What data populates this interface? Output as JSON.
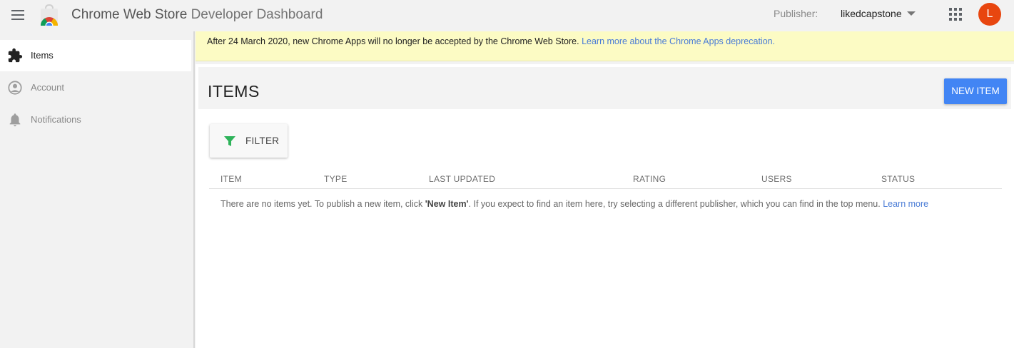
{
  "header": {
    "title_strong": "Chrome Web Store",
    "title_light": "Developer Dashboard",
    "publisher_label": "Publisher:",
    "publisher_value": "likedcapstone",
    "avatar_initial": "L"
  },
  "sidebar": {
    "items": [
      {
        "label": "Items",
        "icon": "puzzle-icon",
        "active": true
      },
      {
        "label": "Account",
        "icon": "account-circle-icon",
        "active": false
      },
      {
        "label": "Notifications",
        "icon": "bell-icon",
        "active": false
      }
    ]
  },
  "banner": {
    "text": "After 24 March 2020, new Chrome Apps will no longer be accepted by the Chrome Web Store.",
    "link": "Learn more about the Chrome Apps deprecation."
  },
  "main": {
    "title": "ITEMS",
    "new_button": "NEW ITEM",
    "filter_button": "FILTER",
    "columns": [
      "ITEM",
      "TYPE",
      "LAST UPDATED",
      "RATING",
      "USERS",
      "STATUS"
    ],
    "empty_before": "There are no items yet. To publish a new item, click ",
    "empty_bold": "'New Item'",
    "empty_after": ". If you expect to find an item here, try selecting a different publisher, which you can find in the top menu. ",
    "empty_link": "Learn more"
  },
  "colors": {
    "accent": "#4285f4",
    "avatar": "#e8460f",
    "banner_bg": "#fcfbc4",
    "link": "#4a7cd6",
    "filter_icon": "#2eb35a"
  }
}
